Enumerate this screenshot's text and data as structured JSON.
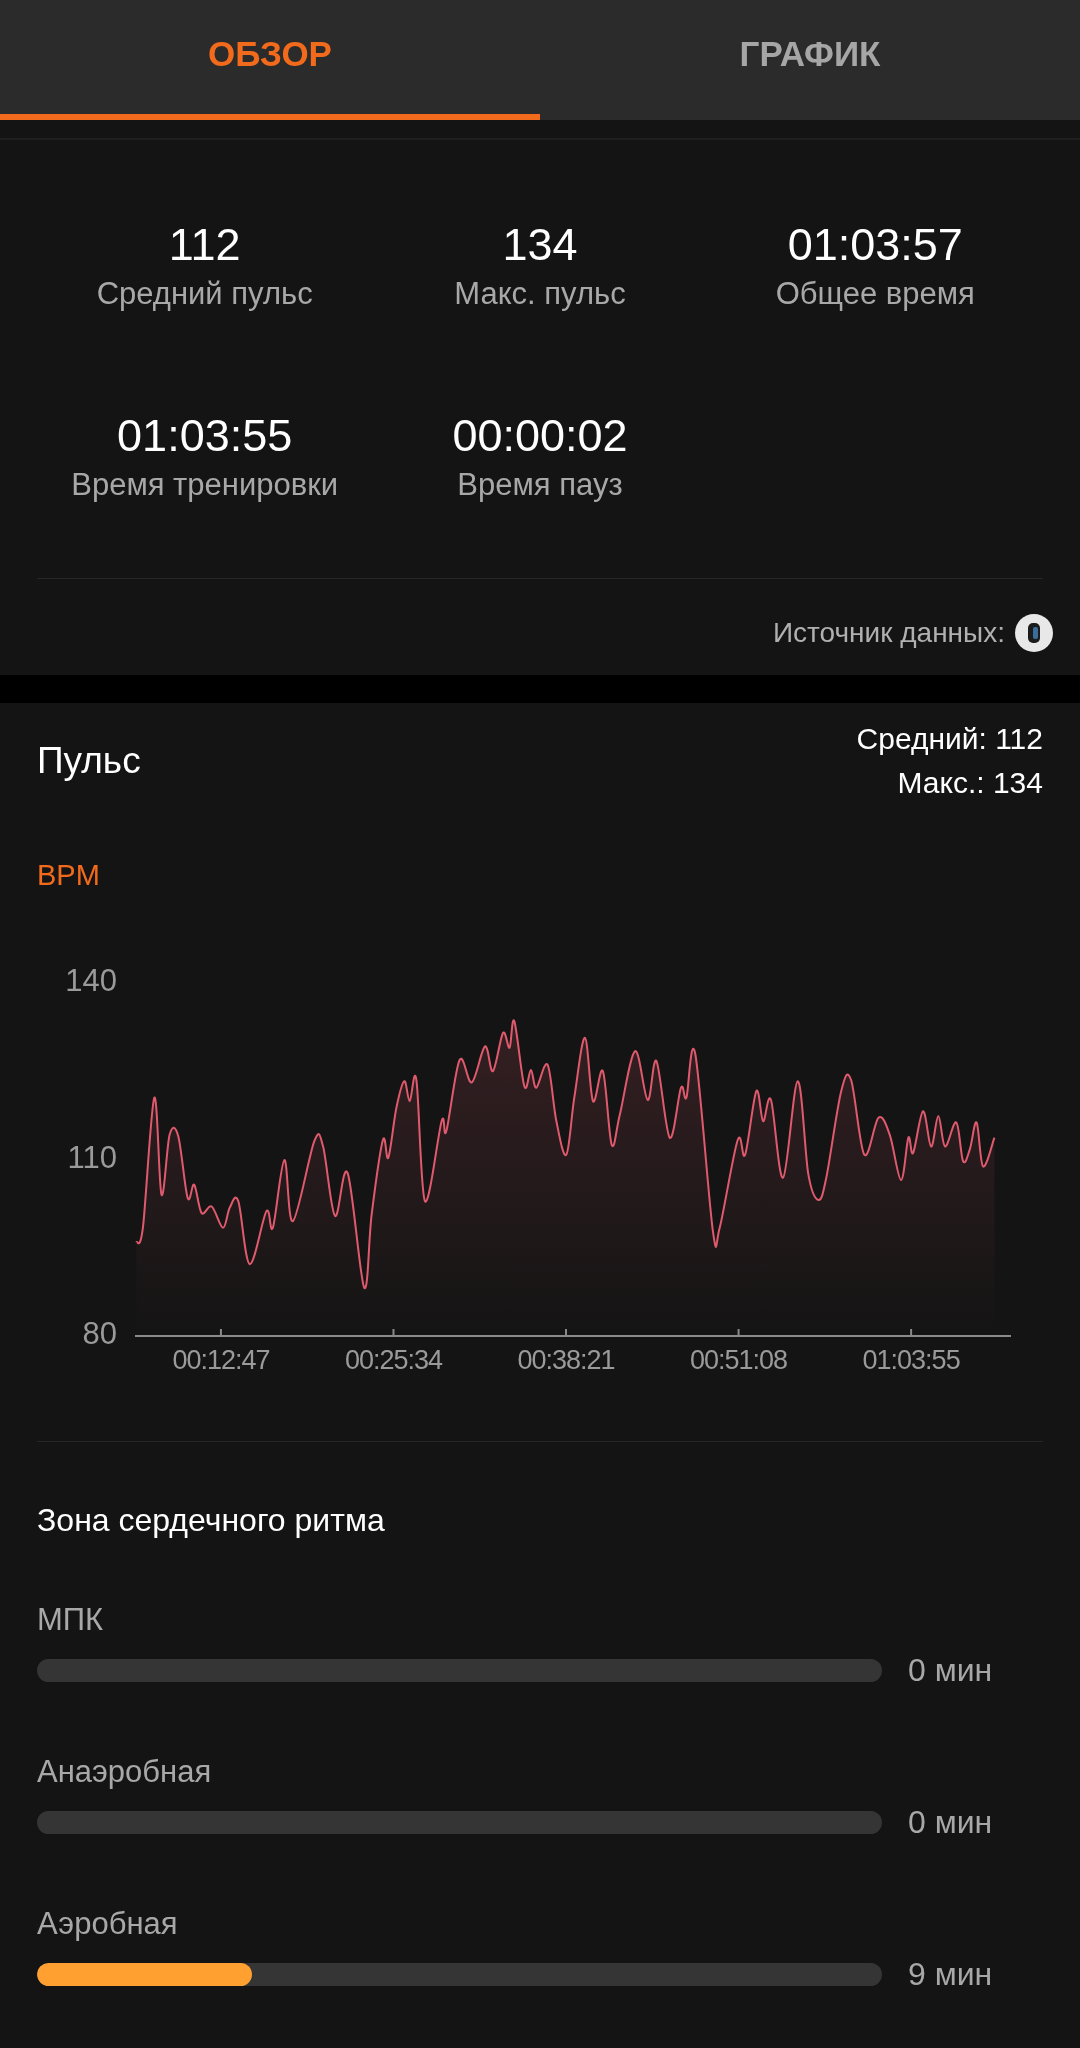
{
  "tabs": [
    {
      "label": "ОБЗОР",
      "selected": true
    },
    {
      "label": "ГРАФИК",
      "selected": false
    }
  ],
  "stats": [
    {
      "value": "112",
      "label": "Средний пульс"
    },
    {
      "value": "134",
      "label": "Макс. пульс"
    },
    {
      "value": "01:03:57",
      "label": "Общее время"
    },
    {
      "value": "01:03:55",
      "label": "Время тренировки"
    },
    {
      "value": "00:00:02",
      "label": "Время пауз"
    }
  ],
  "data_source": {
    "label": "Источник данных:"
  },
  "pulse": {
    "title": "Пульс",
    "summary": [
      "Средний: 112",
      "Макс.: 134"
    ],
    "chart_data": {
      "type": "area",
      "ylabel": "BPM",
      "xlim": [
        385,
        4279
      ],
      "ylim": [
        80,
        140
      ],
      "yticks": [
        80,
        110,
        140
      ],
      "xticks": [
        {
          "value": 767,
          "label": "00:12:47"
        },
        {
          "value": 1534,
          "label": "00:25:34"
        },
        {
          "value": 2301,
          "label": "00:38:21"
        },
        {
          "value": 3068,
          "label": "00:51:08"
        },
        {
          "value": 3835,
          "label": "01:03:55"
        }
      ],
      "x": [
        391,
        420,
        471,
        503,
        539,
        577,
        619,
        648,
        681,
        726,
        776,
        806,
        844,
        895,
        969,
        998,
        1049,
        1087,
        1182,
        1221,
        1274,
        1330,
        1404,
        1437,
        1487,
        1511,
        1547,
        1582,
        1606,
        1636,
        1674,
        1748,
        1769,
        1828,
        1882,
        1941,
        1976,
        2021,
        2050,
        2071,
        2116,
        2145,
        2169,
        2219,
        2258,
        2302,
        2338,
        2385,
        2421,
        2465,
        2504,
        2540,
        2608,
        2664,
        2703,
        2762,
        2812,
        2836,
        2875,
        2954,
        2984,
        3064,
        3097,
        3147,
        3177,
        3212,
        3266,
        3331,
        3378,
        3423,
        3458,
        3524,
        3568,
        3627,
        3690,
        3740,
        3790,
        3823,
        3844,
        3888,
        3924,
        3956,
        3986,
        4036,
        4066,
        4096,
        4126,
        4155,
        4205
      ],
      "series": [
        {
          "color": "#e05a6e",
          "values": [
            95.4,
            97.9,
            120,
            103.5,
            113.7,
            113.5,
            103,
            105.2,
            100.4,
            101.5,
            97.9,
            101.3,
            102.4,
            91.7,
            100.7,
            97.9,
            109.4,
            99,
            112.6,
            111.7,
            99.9,
            107.2,
            87.7,
            100.2,
            112.8,
            109.8,
            118.3,
            122.8,
            119.4,
            123,
            102.4,
            116,
            114.3,
            126.4,
            122.6,
            128.7,
            124.5,
            131,
            128.5,
            133,
            121.9,
            124.7,
            121.7,
            125.6,
            116,
            110.3,
            120,
            130.2,
            119.4,
            124.5,
            112,
            117.1,
            127.9,
            119.6,
            126.2,
            113.2,
            121.7,
            120,
            127.5,
            97.3,
            97.9,
            112.8,
            110.3,
            121.1,
            116,
            119.6,
            106.4,
            122.8,
            107,
            102.6,
            106.4,
            121.1,
            123,
            110.3,
            116.6,
            113.7,
            106,
            113.2,
            110.6,
            117.7,
            111.7,
            116.9,
            111.7,
            115.8,
            109.2,
            111.2,
            115.8,
            108.3,
            113.2
          ]
        }
      ]
    }
  },
  "zones": {
    "title": "Зона сердечного ритма",
    "items": [
      {
        "label": "МПК",
        "value": "0 мин"
      },
      {
        "label": "Анаэробная",
        "value": "0 мин"
      },
      {
        "label": "Аэробная",
        "level": 0.254,
        "value": "9 мин"
      }
    ]
  }
}
